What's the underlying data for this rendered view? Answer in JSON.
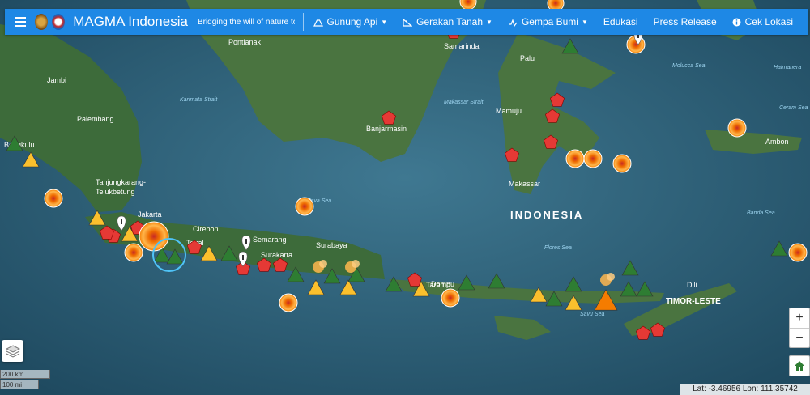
{
  "navbar": {
    "brand": "MAGMA Indonesia",
    "tagline": "Bridging the will of nature to society",
    "menu": [
      {
        "label": "Gunung Api",
        "icon": "volcano-icon",
        "dropdown": true
      },
      {
        "label": "Gerakan Tanah",
        "icon": "landslide-icon",
        "dropdown": true
      },
      {
        "label": "Gempa Bumi",
        "icon": "earthquake-icon",
        "dropdown": true
      },
      {
        "label": "Edukasi",
        "dropdown": false
      },
      {
        "label": "Press Release",
        "dropdown": false
      },
      {
        "label": "Cek Lokasi",
        "icon": "info-icon",
        "dropdown": false
      }
    ]
  },
  "map": {
    "country_label": "INDONESIA",
    "neighbor_label": "TIMOR-LESTE",
    "city_labels": [
      "Pontianak",
      "Samarinda",
      "Jambi",
      "Palu",
      "Palembang",
      "Mamuju",
      "Banjarmasin",
      "Bengkulu",
      "Ambon",
      "Tanjungkarang-",
      "Telukbetung",
      "Makassar",
      "Jakarta",
      "Cirebon",
      "Tegal",
      "Semarang",
      "Surakarta",
      "Surabaya",
      "Dili",
      "Dompu",
      "Taramo"
    ],
    "sea_labels": [
      "Karimata Strait",
      "Makassar Strait",
      "Java Sea",
      "Flores Sea",
      "Banda Sea",
      "Molucca Sea",
      "Savu Sea",
      "Ceram Sea",
      "Halmahera"
    ],
    "colors": {
      "volcano_normal": "#2e7d32",
      "volcano_alert": "#fbc02d",
      "volcano_warning": "#f57c00",
      "landslide": "#e53935",
      "earthquake": "#ff9800"
    }
  },
  "controls": {
    "zoom_in": "+",
    "zoom_out": "−",
    "scale_km": "200 km",
    "scale_mi": "100 mi"
  },
  "status": {
    "coordinates": "Lat: -3.46956 Lon: 111.35742"
  }
}
